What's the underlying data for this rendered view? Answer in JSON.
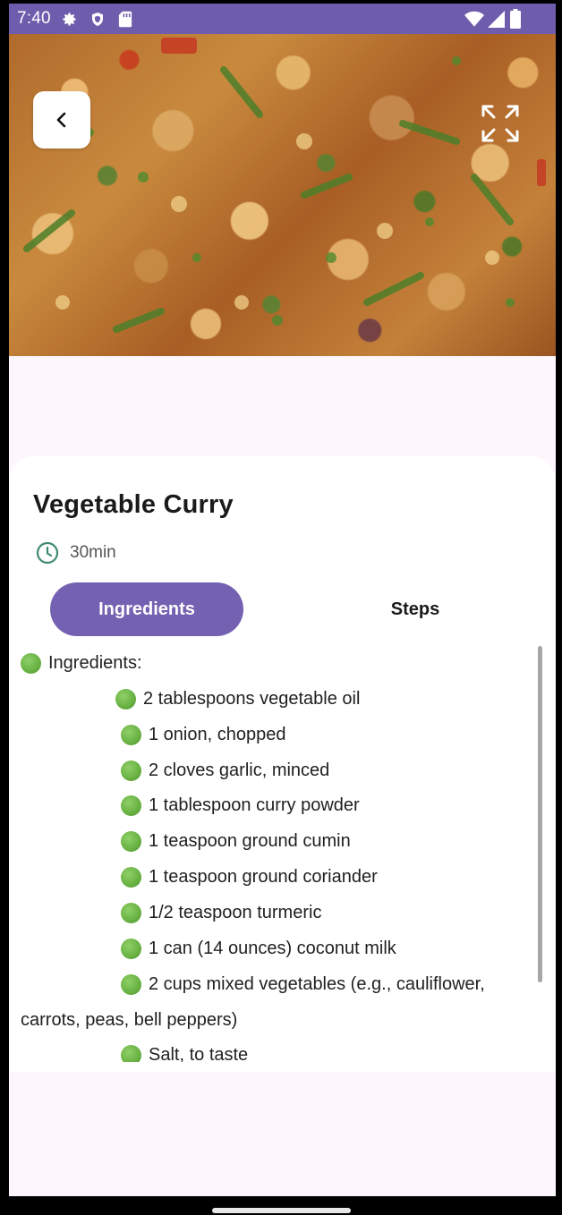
{
  "status_bar": {
    "time": "7:40",
    "left_icons": [
      "gear-icon",
      "shield-icon",
      "sd-card-icon"
    ],
    "right_icons": [
      "wifi-icon",
      "signal-icon",
      "battery-icon"
    ],
    "color": "#6e5cad"
  },
  "header": {
    "back_icon": "chevron-left-icon",
    "fullscreen_icon": "expand-icon"
  },
  "recipe": {
    "title": "Vegetable Curry",
    "time_icon": "clock-icon",
    "time": "30min"
  },
  "tabs": [
    {
      "label": "Ingredients",
      "active": true
    },
    {
      "label": "Steps",
      "active": false
    }
  ],
  "ingredients": {
    "heading": "Ingredients:",
    "items": [
      "2 tablespoons vegetable oil",
      "1 onion, chopped",
      "2 cloves garlic, minced",
      "1 tablespoon curry powder",
      "1 teaspoon ground cumin",
      "1 teaspoon ground coriander",
      "1/2 teaspoon turmeric",
      "1 can (14 ounces) coconut milk",
      "2 cups mixed vegetables (e.g., cauliflower,",
      "carrots, peas, bell peppers)",
      "Salt, to taste"
    ],
    "bullet_icon": "green-circle-emoji"
  },
  "colors": {
    "accent": "#7461b2",
    "bullet": "#6bb444",
    "clock": "#3f8a6e"
  }
}
